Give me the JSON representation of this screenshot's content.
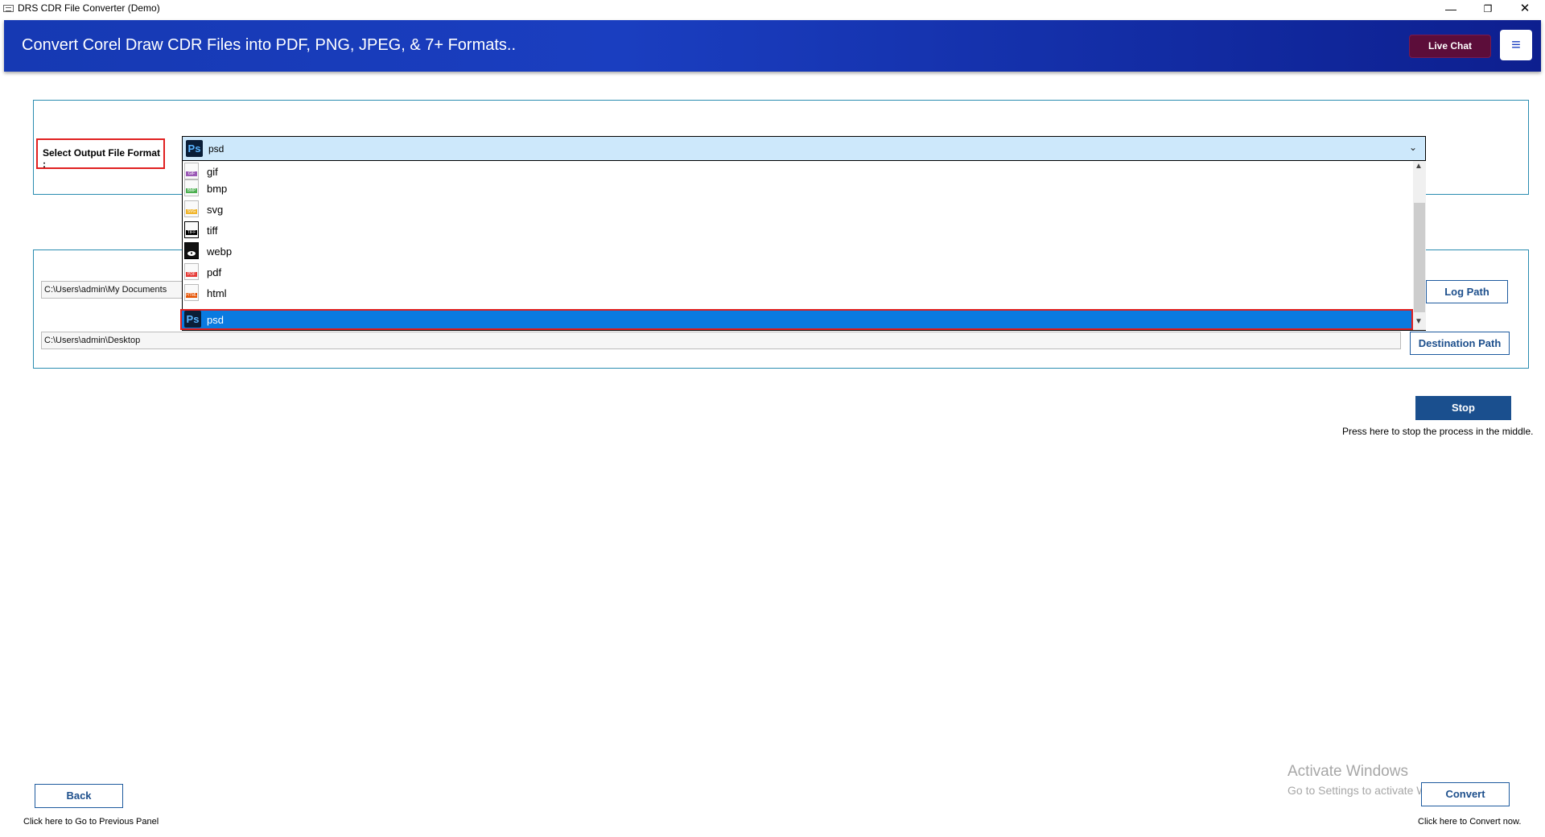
{
  "window": {
    "title": "DRS CDR File Converter (Demo)",
    "controls": {
      "minimize": "—",
      "maximize": "❐",
      "close": "✕"
    }
  },
  "header": {
    "title": "Convert Corel Draw CDR Files into PDF, PNG, JPEG, & 7+ Formats..",
    "live_chat_label": "Live Chat",
    "menu_icon": "≡"
  },
  "format": {
    "label": "Select Output File Format :",
    "selected": "psd",
    "options": [
      {
        "label": "gif",
        "icon": "gif-file-icon",
        "color": "#9b59b6"
      },
      {
        "label": "bmp",
        "icon": "bmp-file-icon",
        "color": "#4caf50"
      },
      {
        "label": "svg",
        "icon": "svg-file-icon",
        "color": "#f0b429"
      },
      {
        "label": "tiff",
        "icon": "tiff-file-icon",
        "color": "#000000"
      },
      {
        "label": "webp",
        "icon": "webp-file-icon",
        "color": "#000000"
      },
      {
        "label": "pdf",
        "icon": "pdf-file-icon",
        "color": "#e53935"
      },
      {
        "label": "html",
        "icon": "html-file-icon",
        "color": "#e65100"
      },
      {
        "label": "psd",
        "icon": "photoshop-icon",
        "color": "#0a1e38"
      }
    ]
  },
  "paths": {
    "log_path_value": "C:\\Users\\admin\\My Documents",
    "log_path_button": "Log Path",
    "destination_value": "C:\\Users\\admin\\Desktop",
    "destination_button": "Destination Path"
  },
  "actions": {
    "stop_label": "Stop",
    "stop_hint": "Press here to stop the process in the middle.",
    "back_label": "Back",
    "back_hint": "Click here to Go to Previous Panel",
    "convert_label": "Convert",
    "convert_hint": "Click here to Convert now."
  },
  "watermark": {
    "title": "Activate Windows",
    "subtitle": "Go to Settings to activate Windows."
  },
  "colors": {
    "header_start": "#1639b3",
    "header_end": "#0d1f8f",
    "live_chat": "#5c0d3a",
    "selection": "#0a7ae0",
    "highlight_border": "#e02020",
    "panel_border": "#2a8cb0",
    "stop_button": "#1a4f8e"
  }
}
